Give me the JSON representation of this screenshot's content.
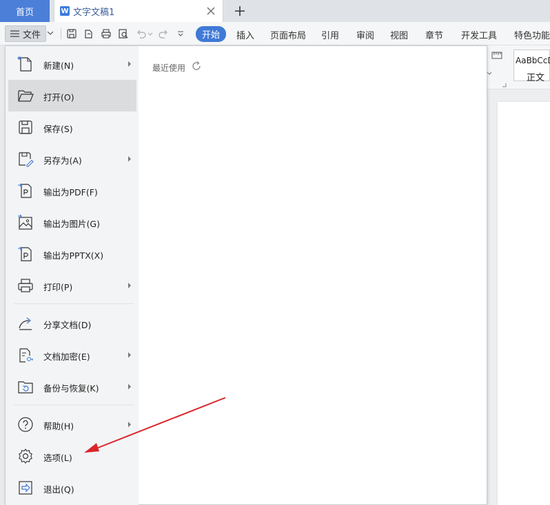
{
  "tabs": {
    "home": "首页",
    "document": "文字文稿1"
  },
  "toolbar": {
    "file_label": "文件",
    "menu_tabs": [
      "开始",
      "插入",
      "页面布局",
      "引用",
      "审阅",
      "视图",
      "章节",
      "开发工具",
      "特色功能"
    ],
    "active_tab": "开始"
  },
  "ribbon": {
    "style_sample": "AaBbCcD",
    "style_name": "正文"
  },
  "file_menu": {
    "items": [
      {
        "label": "新建(N)",
        "icon": "new-file-icon",
        "submenu": true
      },
      {
        "label": "打开(O)",
        "icon": "folder-open-icon",
        "submenu": false
      },
      {
        "label": "保存(S)",
        "icon": "save-icon",
        "submenu": false
      },
      {
        "label": "另存为(A)",
        "icon": "save-as-icon",
        "submenu": true
      },
      {
        "label": "输出为PDF(F)",
        "icon": "export-pdf-icon",
        "submenu": false
      },
      {
        "label": "输出为图片(G)",
        "icon": "export-image-icon",
        "submenu": false
      },
      {
        "label": "输出为PPTX(X)",
        "icon": "export-pptx-icon",
        "submenu": false
      },
      {
        "label": "打印(P)",
        "icon": "print-icon",
        "submenu": true
      },
      {
        "label": "分享文档(D)",
        "icon": "share-icon",
        "submenu": false
      },
      {
        "label": "文档加密(E)",
        "icon": "encrypt-icon",
        "submenu": true
      },
      {
        "label": "备份与恢复(K)",
        "icon": "backup-icon",
        "submenu": true
      },
      {
        "label": "帮助(H)",
        "icon": "help-icon",
        "submenu": true
      },
      {
        "label": "选项(L)",
        "icon": "gear-icon",
        "submenu": false
      },
      {
        "label": "退出(Q)",
        "icon": "exit-icon",
        "submenu": false
      }
    ],
    "hovered_item": "打开(O)"
  },
  "recent": {
    "title": "最近使用"
  },
  "colors": {
    "accent": "#3f7ad6",
    "home_tab": "#4c7fd8",
    "annotation_arrow": "#d9262b"
  }
}
